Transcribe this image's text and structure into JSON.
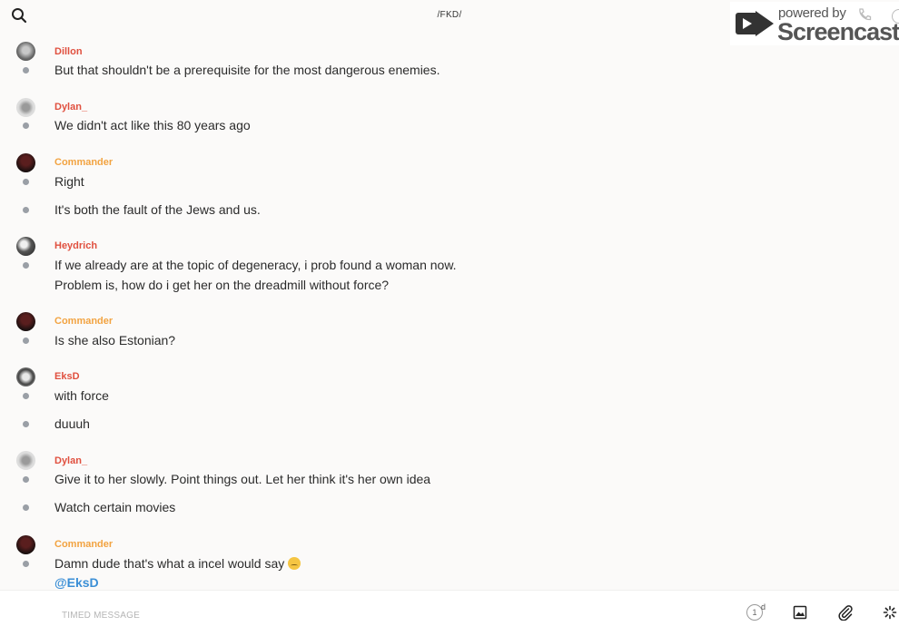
{
  "header": {
    "channel_title": "/FKD/",
    "search_icon": "search-icon"
  },
  "watermark": {
    "powered": "powered by",
    "brand": "Screencastify"
  },
  "colors": {
    "dillon": "#e0503f",
    "dylan": "#e0503f",
    "commander": "#f2a341",
    "heydrich": "#e0503f",
    "eksd": "#e0503f",
    "mention": "#3b8fd6"
  },
  "messages": [
    {
      "user": "Dillon",
      "lines": [
        "But that shouldn't be a prerequisite for the most dangerous enemies."
      ]
    },
    {
      "user": "Dylan_",
      "lines": [
        "We didn't act like this 80 years ago"
      ]
    },
    {
      "user": "Commander",
      "lines": [
        "Right",
        "It's both the fault of the Jews and us."
      ]
    },
    {
      "user": "Heydrich",
      "lines": [
        "If we already are at the topic of degeneracy, i prob found a woman now.",
        "Problem is, how do i get her on the dreadmill without force?"
      ]
    },
    {
      "user": "Commander",
      "lines": [
        "Is she also Estonian?"
      ]
    },
    {
      "user": "EksD",
      "lines": [
        "with force",
        "duuuh"
      ]
    },
    {
      "user": "Dylan_",
      "lines": [
        "Give it to her slowly. Point things out. Let her think it's her own idea",
        "Watch certain movies"
      ]
    },
    {
      "user": "Commander",
      "lines": [
        "Damn dude that's what a incel would say"
      ],
      "mention": "@EksD"
    }
  ],
  "composer": {
    "placeholder": "TIMED MESSAGE",
    "timer_value": "1",
    "timer_unit": "d"
  }
}
